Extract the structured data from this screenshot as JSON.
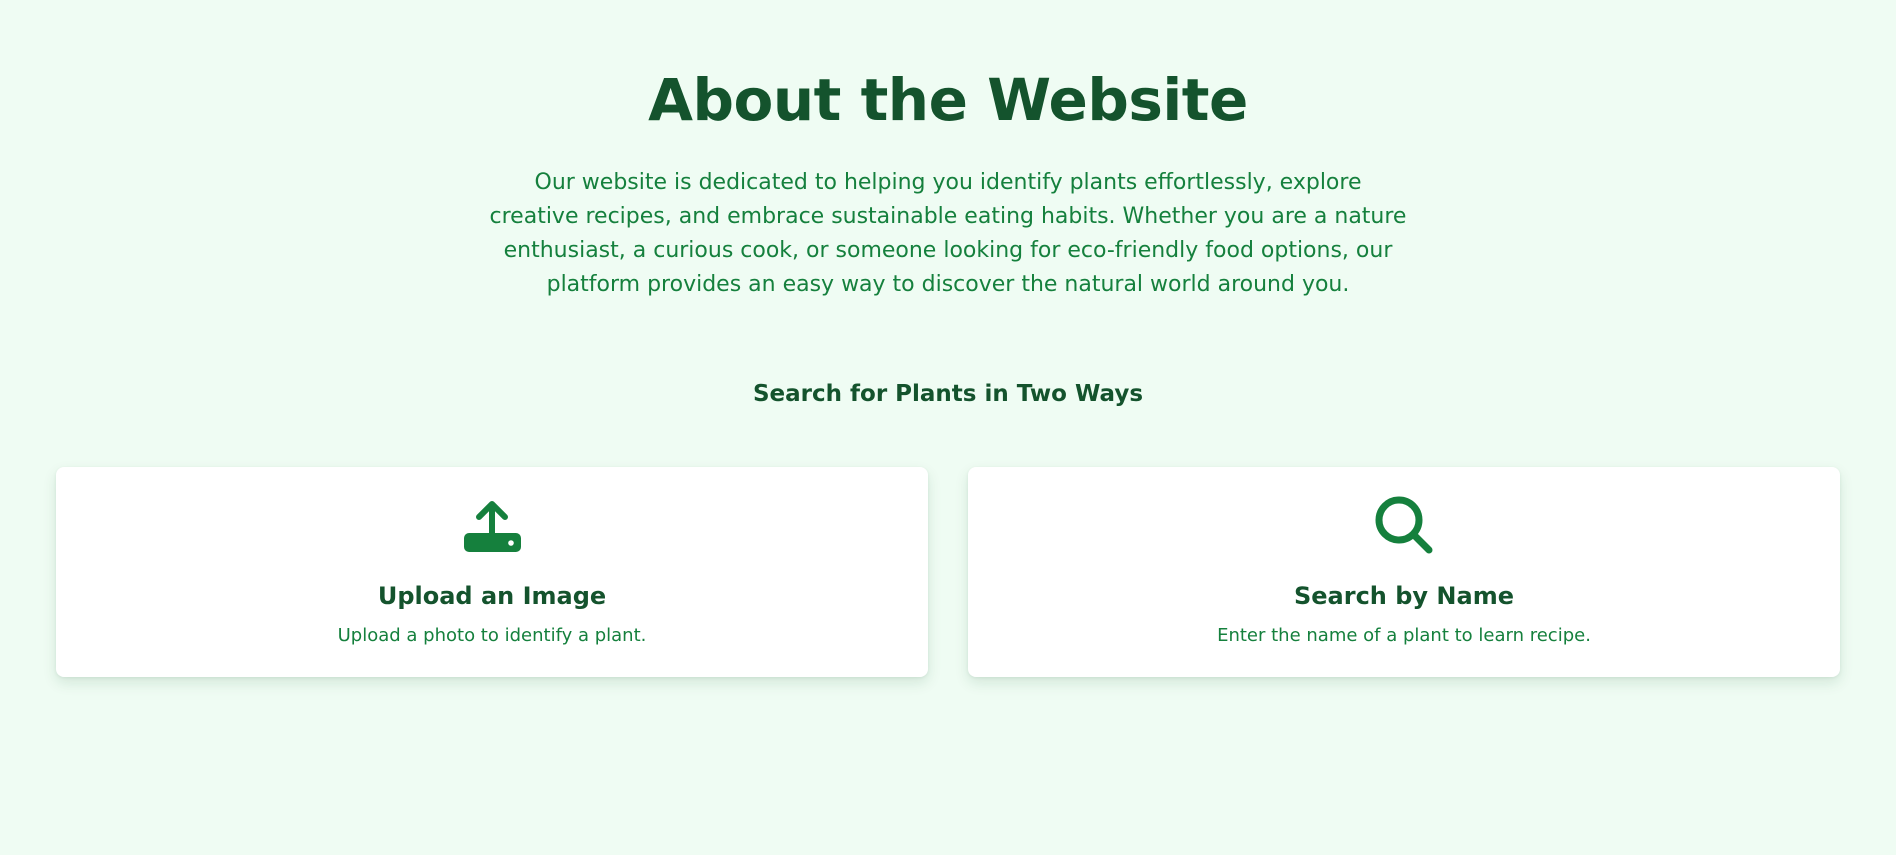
{
  "about": {
    "title": "About the Website",
    "description": "Our website is dedicated to helping you identify plants effortlessly, explore creative recipes, and embrace sustainable eating habits. Whether you are a nature enthusiast, a curious cook, or someone looking for eco-friendly food options, our platform provides an easy way to discover the natural world around you."
  },
  "search_section": {
    "title": "Search for Plants in Two Ways",
    "cards": [
      {
        "icon": "upload-icon",
        "title": "Upload an Image",
        "description": "Upload a photo to identify a plant."
      },
      {
        "icon": "search-icon",
        "title": "Search by Name",
        "description": "Enter the name of a plant to learn recipe."
      }
    ]
  },
  "colors": {
    "background": "#effcf3",
    "heading": "#14532d",
    "text": "#15803d",
    "icon": "#15803d",
    "card": "#ffffff"
  }
}
